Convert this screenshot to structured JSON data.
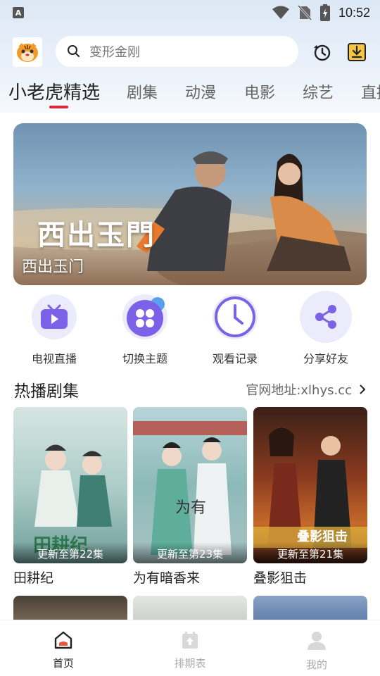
{
  "status_bar": {
    "time": "10:52",
    "left_badge": "A"
  },
  "search": {
    "placeholder": "变形金刚"
  },
  "tabs": [
    {
      "label": "小老虎精选",
      "active": true
    },
    {
      "label": "剧集"
    },
    {
      "label": "动漫"
    },
    {
      "label": "电影"
    },
    {
      "label": "综艺"
    },
    {
      "label": "直播"
    }
  ],
  "banner": {
    "title": "西出玉门",
    "art_title": "西出玉門"
  },
  "quick_actions": [
    {
      "label": "电视直播",
      "icon": "tv-icon"
    },
    {
      "label": "切换主题",
      "icon": "theme-icon"
    },
    {
      "label": "观看记录",
      "icon": "clock-icon"
    },
    {
      "label": "分享好友",
      "icon": "share-icon"
    }
  ],
  "section": {
    "title": "热播剧集",
    "link": "官网地址:xlhys.cc"
  },
  "cards": [
    {
      "title": "田耕纪",
      "badge": "更新至第22集"
    },
    {
      "title": "为有暗香来",
      "badge": "更新至第23集"
    },
    {
      "title": "叠影狙击",
      "badge": "更新至第21集"
    }
  ],
  "bottom_nav": [
    {
      "label": "首页",
      "active": true
    },
    {
      "label": "排期表"
    },
    {
      "label": "我的"
    }
  ],
  "colors": {
    "accent": "#d9283a",
    "purple": "#7b62e8",
    "quick_bg": "#ecebfb"
  }
}
